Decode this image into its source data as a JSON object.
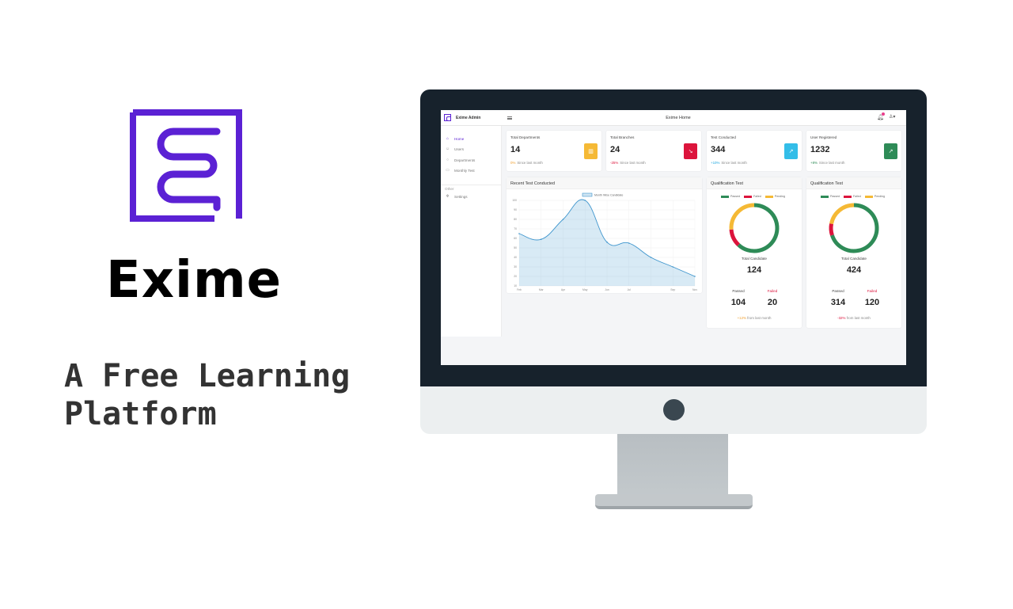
{
  "promo": {
    "brand_name": "Exime",
    "tagline": "A Free Learning\nPlatform"
  },
  "colors": {
    "brand": "#5b21d4",
    "monitor_frame": "#17222c",
    "passed": "#2e8b57",
    "failed": "#dc143c",
    "pending": "#f5b935"
  },
  "app": {
    "topbar": {
      "logo_icon": "exime-logo-icon",
      "name": "Exime Admin",
      "menu_icon": "hamburger-menu-icon",
      "page_title": "Exime Home",
      "bell_icon": "bell-icon",
      "user_icon": "user-icon",
      "user_caret": "▾"
    },
    "sidebar": {
      "items": [
        {
          "label": "Home",
          "icon": "home-icon",
          "glyph": "⌂",
          "active": true
        },
        {
          "label": "Users",
          "icon": "users-icon",
          "glyph": "☺",
          "active": false
        },
        {
          "label": "Departments",
          "icon": "departments-icon",
          "glyph": "○",
          "active": false
        },
        {
          "label": "Monthly Test",
          "icon": "calendar-icon",
          "glyph": "▭",
          "active": false
        }
      ],
      "group_label": "Other",
      "other_items": [
        {
          "label": "Settings",
          "icon": "settings-icon",
          "glyph": "✻"
        }
      ]
    },
    "stats": [
      {
        "title": "Total Departments",
        "value": "14",
        "change": "0%",
        "change_color": "#f0a030",
        "foot": "Since last month",
        "icon": "bar-chart-icon",
        "glyph": "▥",
        "icon_bg": "#f5b935"
      },
      {
        "title": "Total Branches",
        "value": "24",
        "change": "-25%",
        "change_color": "#dc143c",
        "foot": "Since last month",
        "icon": "trend-down-icon",
        "glyph": "↘",
        "icon_bg": "#dc143c"
      },
      {
        "title": "Test Conducted",
        "value": "344",
        "change": "+10%",
        "change_color": "#1ea7e0",
        "foot": "Since last month",
        "icon": "trend-up-icon",
        "glyph": "↗",
        "icon_bg": "#33bde8"
      },
      {
        "title": "User Registered",
        "value": "1232",
        "change": "+8%",
        "change_color": "#2e8b57",
        "foot": "Since last month",
        "icon": "line-chart-icon",
        "glyph": "↗",
        "icon_bg": "#2e8b57"
      }
    ],
    "recent_chart": {
      "panel_title": "Recent Test Conducted"
    },
    "qualification": [
      {
        "title": "Qualification Test",
        "total_label": "Total Candidate",
        "total": "124",
        "passed_label": "Passed",
        "passed": "104",
        "failed_label": "Failed",
        "failed": "20",
        "change": "+12%",
        "change_color": "#f0a030",
        "foot": "from last month",
        "donut": {
          "passed": 0.62,
          "failed": 0.12,
          "pending": 0.26
        }
      },
      {
        "title": "Qualification Test",
        "total_label": "Total Candidate",
        "total": "424",
        "passed_label": "Passed",
        "passed": "314",
        "failed_label": "Failed",
        "failed": "120",
        "change": "-32%",
        "change_color": "#dc143c",
        "foot": "from last month",
        "donut": {
          "passed": 0.7,
          "failed": 0.08,
          "pending": 0.22
        }
      }
    ],
    "legend_labels": [
      "Passed",
      "Failed",
      "Pending"
    ]
  },
  "chart_data": {
    "type": "area",
    "title": "",
    "legend": [
      "Month Wise Candidate"
    ],
    "categories": [
      "Feb",
      "Mar",
      "Apr",
      "May",
      "Jun",
      "Jul",
      "Sep",
      "Nov"
    ],
    "series": [
      {
        "name": "Month Wise Candidate",
        "values": [
          65,
          59,
          80,
          100,
          56,
          55,
          40,
          30,
          20
        ]
      }
    ],
    "x_points": [
      "Feb",
      "Mar",
      "Apr",
      "May",
      "Jun",
      "Jul",
      "Aug",
      "Sep",
      "Nov"
    ],
    "y_ticks": [
      10,
      20,
      30,
      40,
      50,
      60,
      70,
      80,
      90,
      100
    ],
    "ylim": [
      10,
      100
    ],
    "grid": true,
    "color": "#3e95cd"
  }
}
